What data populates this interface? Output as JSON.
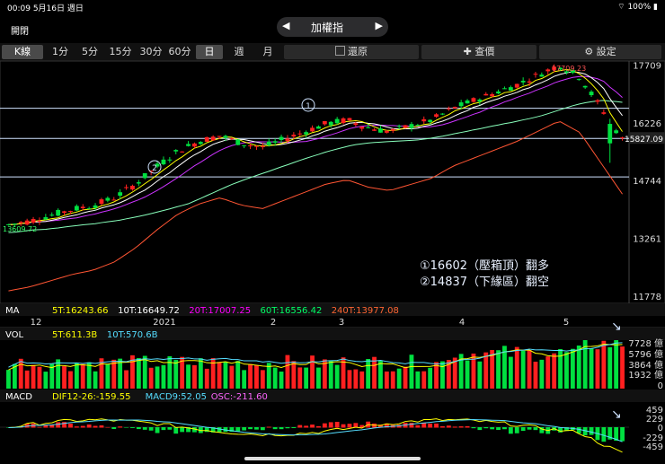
{
  "status": {
    "time": "00:09",
    "date": "5月16日 週日",
    "battery": "100%"
  },
  "header": {
    "close": "開閉",
    "title": "加權指",
    "prev": "◀",
    "next": "▶"
  },
  "toolbar": {
    "kline": "K線",
    "periods": [
      "1分",
      "5分",
      "15分",
      "30分",
      "60分",
      "日",
      "週",
      "月"
    ],
    "restore": "還原",
    "query": "查價",
    "settings": "設定"
  },
  "price_axis": {
    "ticks": [
      "17709",
      "16226",
      "14744",
      "13261",
      "11778"
    ],
    "current": "15827.09"
  },
  "annotations": {
    "high": "17709.23",
    "low": "13609.72",
    "mark1": "①",
    "mark2": "②",
    "note1": "①16602（壓箱頂）翻多",
    "note2": "②14837（下緣區）翻空"
  },
  "date_axis": [
    "12",
    "2021",
    "2",
    "3",
    "4",
    "5"
  ],
  "ma_row": {
    "label": "MA",
    "items": [
      {
        "text": "5T:16243.66",
        "color": "#ffff00"
      },
      {
        "text": "10T:16649.72",
        "color": "#ffffff"
      },
      {
        "text": "20T:17007.25",
        "color": "#ff00ff"
      },
      {
        "text": "60T:16556.42",
        "color": "#00ff66"
      },
      {
        "text": "240T:13977.08",
        "color": "#ff6633"
      }
    ]
  },
  "vol_row": {
    "label": "VOL",
    "items": [
      {
        "text": "5T:611.3B",
        "color": "#ffff00"
      },
      {
        "text": "10T:570.6B",
        "color": "#55ddff"
      }
    ],
    "ticks": [
      "7728 億",
      "5796 億",
      "3864 億",
      "1932 億",
      "0"
    ]
  },
  "macd_row": {
    "label": "MACD",
    "items": [
      {
        "text": "DIF12-26:-159.55",
        "color": "#ffff00"
      },
      {
        "text": "MACD9:52.05",
        "color": "#55ddff"
      },
      {
        "text": "OSC:-211.60",
        "color": "#ff66ff"
      }
    ],
    "ticks": [
      "459",
      "229",
      "0",
      "-229",
      "-459"
    ]
  },
  "colors": {
    "up": "#ff2020",
    "down": "#00e040",
    "ma5": "#ffff00",
    "ma10": "#ffffff",
    "ma20": "#cc33ff",
    "ma60": "#88ffbb",
    "ma240": "#ff5533"
  },
  "chart_data": {
    "type": "candlestick",
    "price_range": [
      11778,
      17709
    ],
    "resistance_lines": [
      16602,
      15827,
      14837
    ],
    "candles_count": 100,
    "trend_points": [
      13610,
      13700,
      13850,
      14000,
      14100,
      14300,
      14650,
      15100,
      15500,
      15750,
      15900,
      15700,
      15600,
      15800,
      16000,
      16200,
      16300,
      16100,
      16000,
      16150,
      16300,
      16600,
      16800,
      17000,
      17200,
      17450,
      17709,
      17400,
      16600,
      15800
    ]
  }
}
